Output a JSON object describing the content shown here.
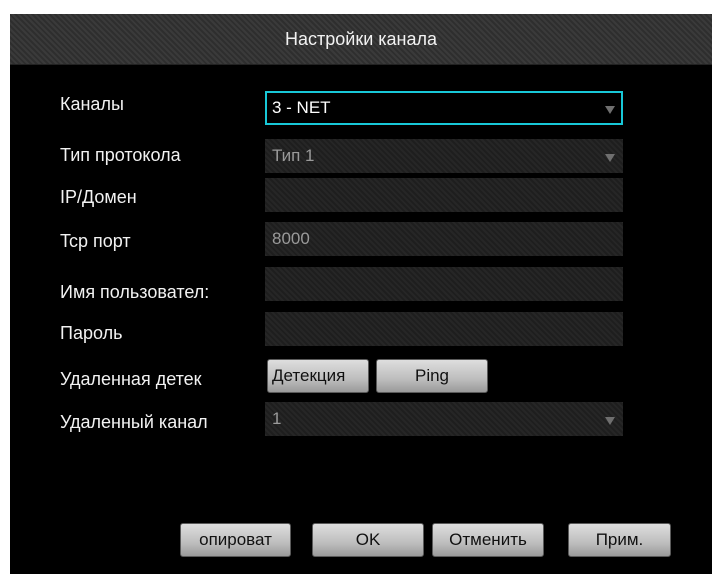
{
  "dialog": {
    "title": "Настройки канала"
  },
  "form": {
    "channels": {
      "label": "Каналы",
      "value": "3 - NET"
    },
    "protocol_type": {
      "label": "Тип протокола",
      "value": "Тип 1"
    },
    "ip_domain": {
      "label": "IP/Домен",
      "value": ""
    },
    "tcp_port": {
      "label": "Tcp порт",
      "value": "8000"
    },
    "username": {
      "label": "Имя пользовател:",
      "value": ""
    },
    "password": {
      "label": "Пароль",
      "value": ""
    },
    "remote_detect": {
      "label": "Удаленная детек",
      "detect_button": "Детекция",
      "ping_button": "Ping"
    },
    "remote_channel": {
      "label": "Удаленный канал",
      "value": "1"
    }
  },
  "footer": {
    "copy_button": "опироват",
    "ok_button": "OK",
    "cancel_button": "Отменить",
    "apply_button": "Прим."
  },
  "colors": {
    "focus_border": "#18c8d8",
    "background": "#000000",
    "text": "#f2f2f2",
    "muted_text": "#9a9a9a"
  },
  "icons": {
    "dropdown": "triangle-down-icon"
  }
}
